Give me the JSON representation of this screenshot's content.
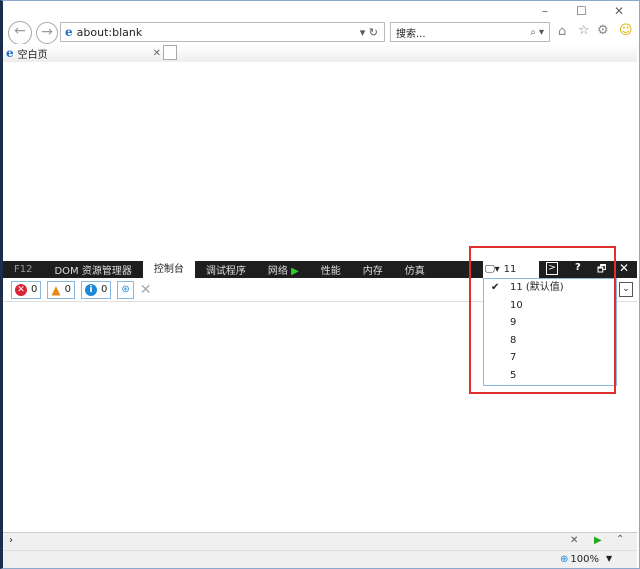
{
  "browser": {
    "address": "about:blank",
    "search_placeholder": "搜索...",
    "tab_title": "空白页"
  },
  "devtools": {
    "f12": "F12",
    "tabs": [
      "DOM 资源管理器",
      "控制台",
      "调试程序",
      "网络",
      "性能",
      "内存",
      "仿真"
    ],
    "active_tab": "控制台",
    "counts": {
      "errors": "0",
      "warnings": "0",
      "info": "0"
    },
    "doc_mode": "11",
    "doc_mode_options": [
      "11 (默认值)",
      "10",
      "9",
      "8",
      "7",
      "5"
    ],
    "selected_option": "11 (默认值)"
  },
  "status": {
    "zoom": "100%"
  }
}
